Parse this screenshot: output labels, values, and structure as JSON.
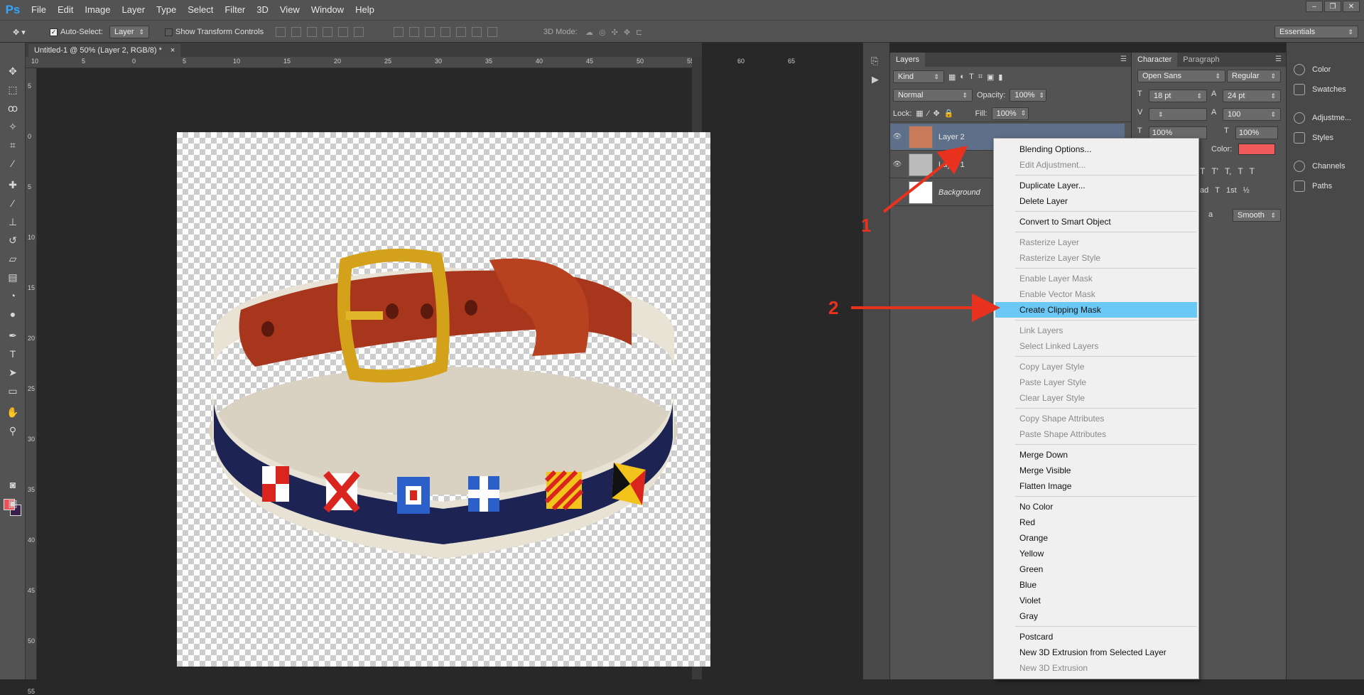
{
  "app": {
    "logo": "Ps"
  },
  "menu": [
    "File",
    "Edit",
    "Image",
    "Layer",
    "Type",
    "Select",
    "Filter",
    "3D",
    "View",
    "Window",
    "Help"
  ],
  "window_controls": [
    "–",
    "❐",
    "✕"
  ],
  "options_bar": {
    "auto_select_label": "Auto-Select:",
    "auto_select_value": "Layer",
    "show_transform_label": "Show Transform Controls",
    "mode_3d_label": "3D Mode:",
    "workspace": "Essentials"
  },
  "document": {
    "tab_title": "Untitled-1 @ 50% (Layer 2, RGB/8) *",
    "close": "×",
    "ruler_top": [
      "10",
      "5",
      "0",
      "5",
      "10",
      "15",
      "20",
      "25",
      "30",
      "35",
      "40",
      "45",
      "50",
      "55",
      "60",
      "65"
    ],
    "ruler_left": [
      "5",
      "0",
      "5",
      "10",
      "15",
      "20",
      "25",
      "30",
      "35",
      "40",
      "45",
      "50",
      "55"
    ]
  },
  "layers_panel": {
    "tab": "Layers",
    "kind": "Kind",
    "blend_mode": "Normal",
    "opacity_label": "Opacity:",
    "opacity": "100%",
    "lock_label": "Lock:",
    "fill_label": "Fill:",
    "fill": "100%",
    "layers": [
      {
        "name": "Layer 2",
        "selected": true
      },
      {
        "name": "Layer 1",
        "selected": false
      },
      {
        "name": "Background",
        "selected": false
      }
    ]
  },
  "character_panel": {
    "tabs": [
      "Character",
      "Paragraph"
    ],
    "font_family": "Open Sans",
    "font_style": "Regular",
    "font_size": "18 pt",
    "leading": "24 pt",
    "tracking": "100",
    "vscale": "100%",
    "hscale": "100%",
    "color_label": "Color:",
    "color": "#f05a5a",
    "antialias": "Smooth",
    "aa_label": "a",
    "type_glyphs": [
      "T",
      "T'",
      "T,",
      "T",
      "T",
      "T"
    ],
    "ot_glyphs": [
      "ad",
      "T",
      "1st",
      "½"
    ]
  },
  "right_dock": {
    "items": [
      "Color",
      "Swatches",
      "Adjustme...",
      "Styles",
      "Channels",
      "Paths"
    ]
  },
  "context_menu": {
    "groups": [
      [
        {
          "label": "Blending Options...",
          "enabled": true
        },
        {
          "label": "Edit Adjustment...",
          "enabled": false
        }
      ],
      [
        {
          "label": "Duplicate Layer...",
          "enabled": true
        },
        {
          "label": "Delete Layer",
          "enabled": true
        }
      ],
      [
        {
          "label": "Convert to Smart Object",
          "enabled": true
        }
      ],
      [
        {
          "label": "Rasterize Layer",
          "enabled": false
        },
        {
          "label": "Rasterize Layer Style",
          "enabled": false
        }
      ],
      [
        {
          "label": "Enable Layer Mask",
          "enabled": false
        },
        {
          "label": "Enable Vector Mask",
          "enabled": false
        },
        {
          "label": "Create Clipping Mask",
          "enabled": true,
          "highlighted": true
        }
      ],
      [
        {
          "label": "Link Layers",
          "enabled": false
        },
        {
          "label": "Select Linked Layers",
          "enabled": false
        }
      ],
      [
        {
          "label": "Copy Layer Style",
          "enabled": false
        },
        {
          "label": "Paste Layer Style",
          "enabled": false
        },
        {
          "label": "Clear Layer Style",
          "enabled": false
        }
      ],
      [
        {
          "label": "Copy Shape Attributes",
          "enabled": false
        },
        {
          "label": "Paste Shape Attributes",
          "enabled": false
        }
      ],
      [
        {
          "label": "Merge Down",
          "enabled": true
        },
        {
          "label": "Merge Visible",
          "enabled": true
        },
        {
          "label": "Flatten Image",
          "enabled": true
        }
      ],
      [
        {
          "label": "No Color",
          "enabled": true
        },
        {
          "label": "Red",
          "enabled": true
        },
        {
          "label": "Orange",
          "enabled": true
        },
        {
          "label": "Yellow",
          "enabled": true
        },
        {
          "label": "Green",
          "enabled": true
        },
        {
          "label": "Blue",
          "enabled": true
        },
        {
          "label": "Violet",
          "enabled": true
        },
        {
          "label": "Gray",
          "enabled": true
        }
      ],
      [
        {
          "label": "Postcard",
          "enabled": true
        },
        {
          "label": "New 3D Extrusion from Selected Layer",
          "enabled": true
        },
        {
          "label": "New 3D Extrusion",
          "enabled": false
        }
      ]
    ]
  },
  "annotations": {
    "step1": "1",
    "step2": "2",
    "color": "#e8321e"
  },
  "swatches": {
    "foreground": "#e8545a",
    "background": "#3a1f49"
  }
}
